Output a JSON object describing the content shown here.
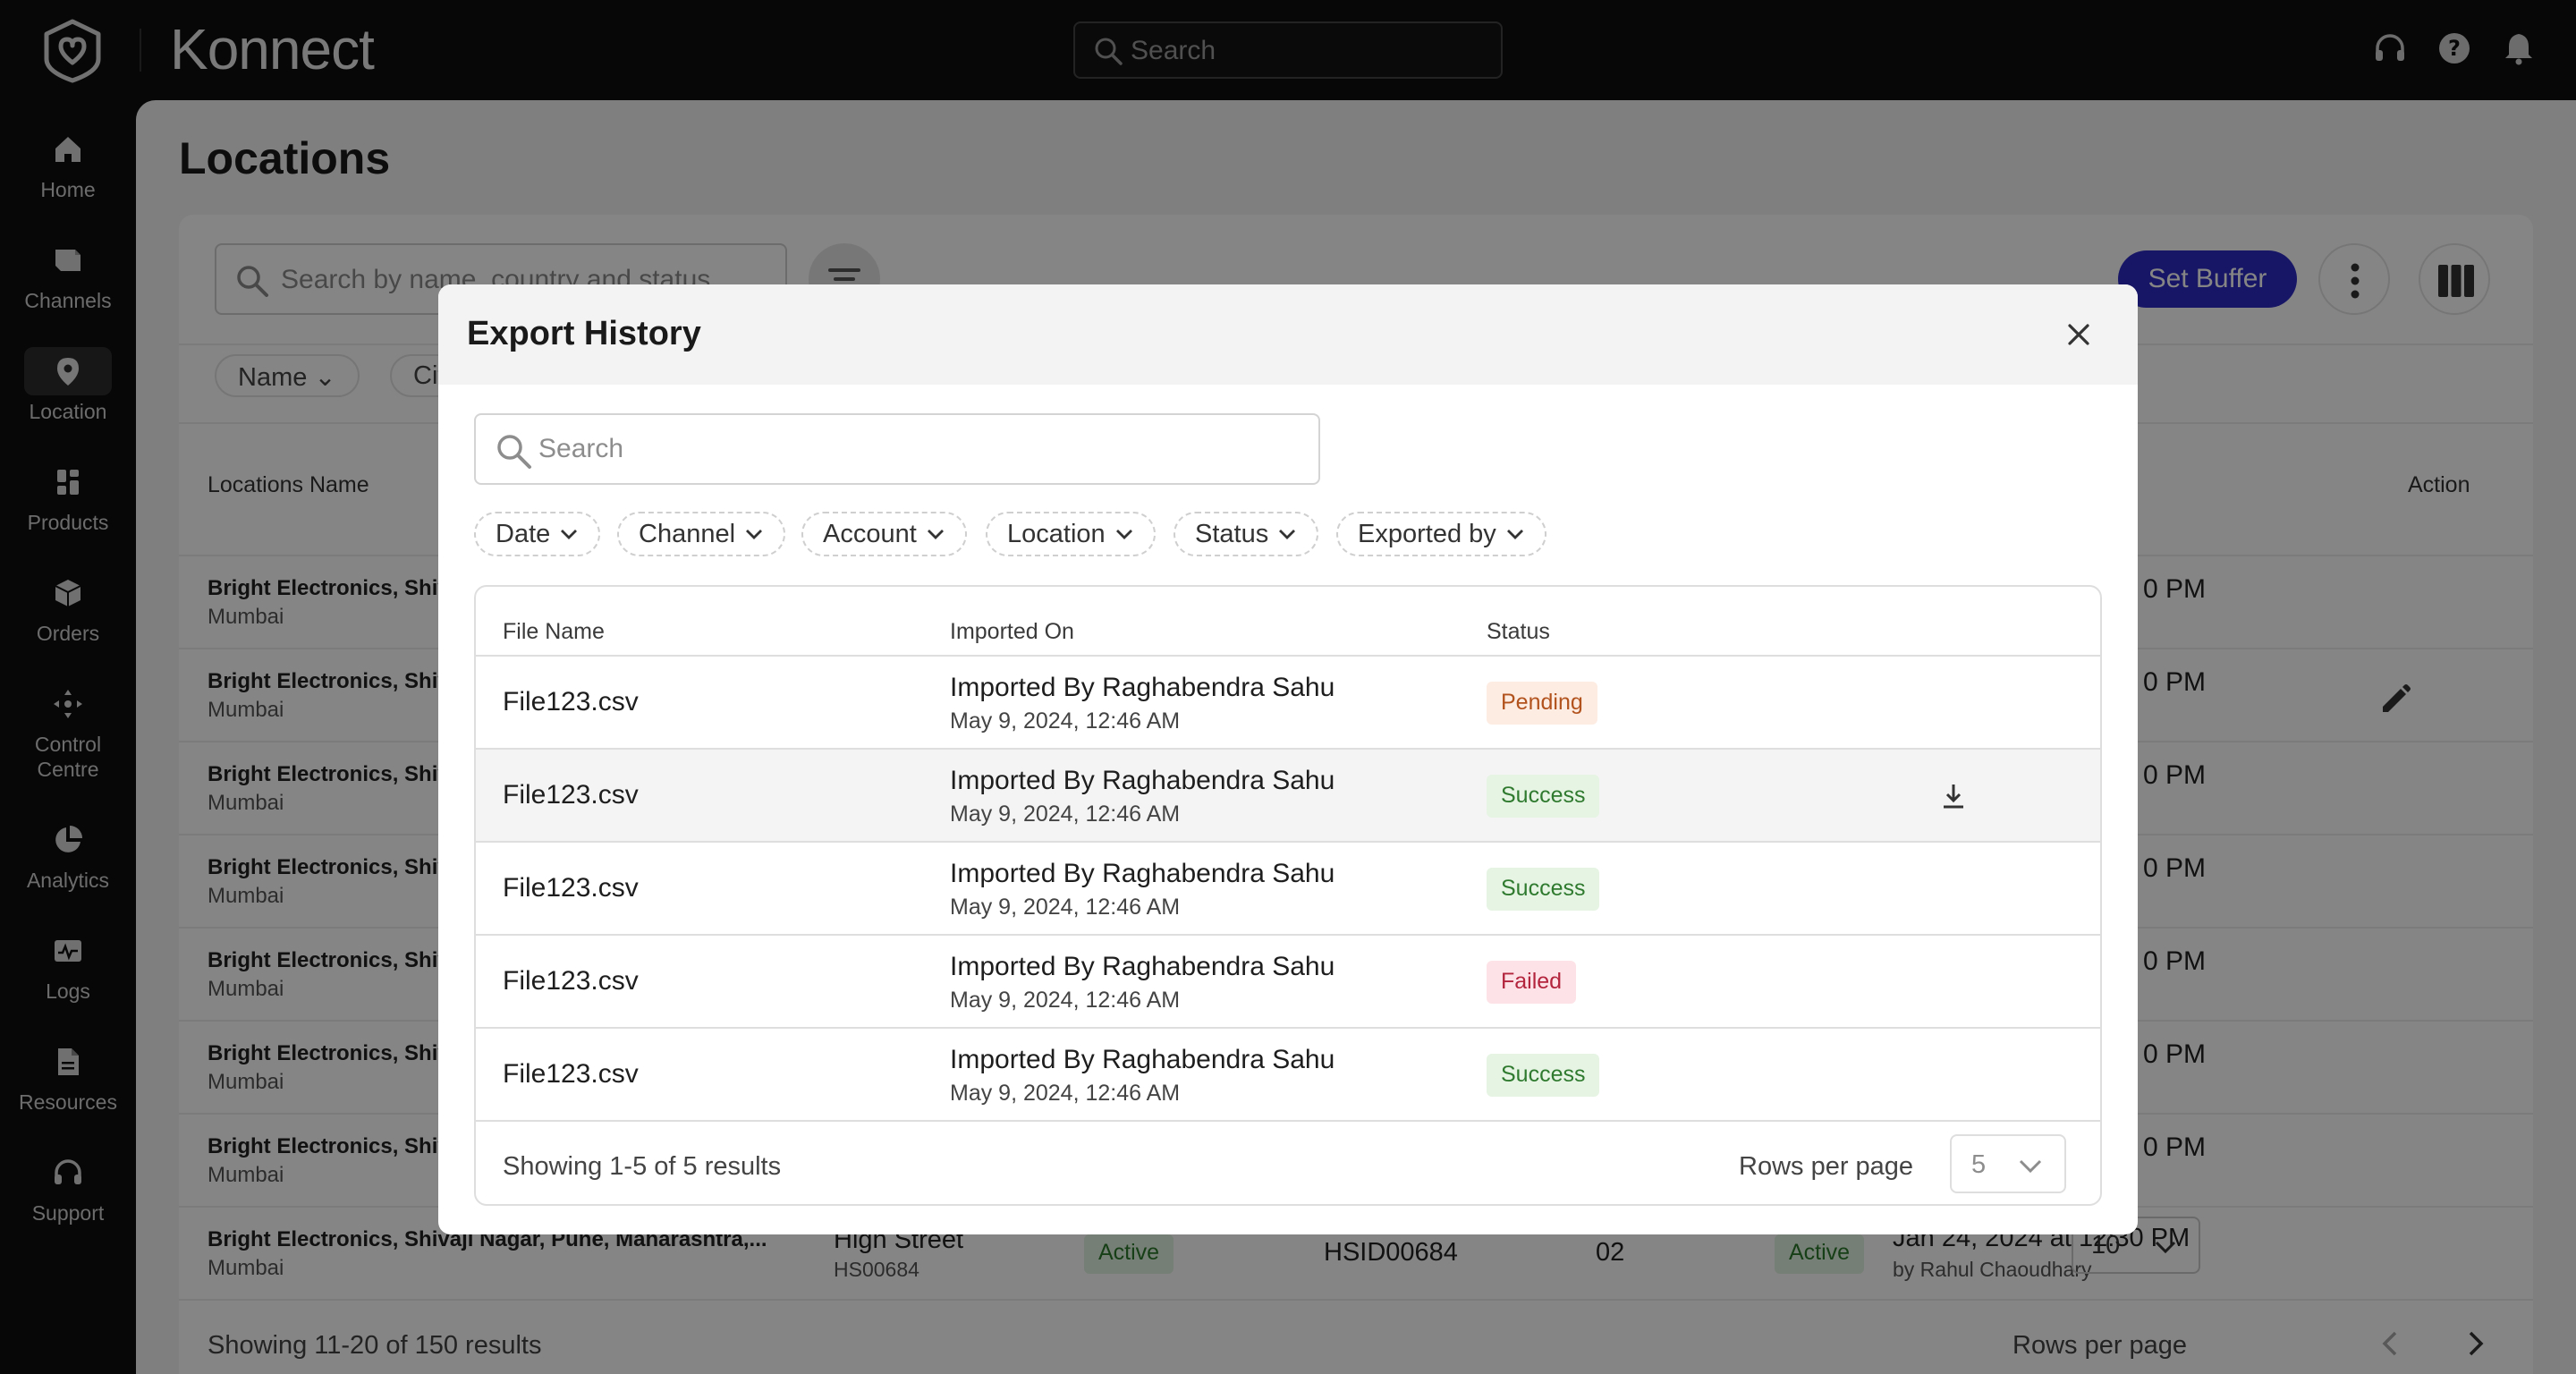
{
  "app": {
    "name": "Konnect",
    "search_placeholder": "Search"
  },
  "sidebar": {
    "items": [
      {
        "label": "Home",
        "icon": "home-icon"
      },
      {
        "label": "Channels",
        "icon": "channels-icon"
      },
      {
        "label": "Location",
        "icon": "location-pin-icon",
        "active": true
      },
      {
        "label": "Products",
        "icon": "products-icon"
      },
      {
        "label": "Orders",
        "icon": "orders-box-icon"
      },
      {
        "label": "Control\nCentre",
        "icon": "control-centre-icon"
      },
      {
        "label": "Analytics",
        "icon": "pie-chart-icon"
      },
      {
        "label": "Logs",
        "icon": "logs-icon"
      },
      {
        "label": "Resources",
        "icon": "document-icon"
      },
      {
        "label": "Support",
        "icon": "headset-icon"
      }
    ]
  },
  "page": {
    "title": "Locations",
    "search_placeholder": "Search by name, country and status",
    "set_buffer_label": "Set Buffer",
    "filter_chips": [
      "Name",
      "City"
    ],
    "columns": {
      "locations_name": "Locations Name",
      "action": "Action"
    },
    "rows": [
      {
        "name": "Bright Electronics, Shiv",
        "city": "Mumbai",
        "time": "0 PM"
      },
      {
        "name": "Bright Electronics, Shiv",
        "city": "Mumbai",
        "time": "0 PM"
      },
      {
        "name": "Bright Electronics, Shiv",
        "city": "Mumbai",
        "time": "0 PM"
      },
      {
        "name": "Bright Electronics, Shiv",
        "city": "Mumbai",
        "time": "0 PM"
      },
      {
        "name": "Bright Electronics, Shiv",
        "city": "Mumbai",
        "time": "0 PM"
      },
      {
        "name": "Bright Electronics, Shiv",
        "city": "Mumbai",
        "time": "0 PM"
      },
      {
        "name": "Bright Electronics, Shiv",
        "city": "Mumbai",
        "time": "0 PM"
      }
    ],
    "last_row": {
      "name": "Bright Electronics, Shivaji Nagar, Pune, Maharashtra,...",
      "city": "Mumbai",
      "street": "High Street",
      "code": "HS00684",
      "status1": "Active",
      "hsid": "HSID00684",
      "num": "02",
      "status2": "Active",
      "datetime": "Jan 24, 2024 at 12:30 PM",
      "by": "by Rahul Chaoudhary"
    },
    "footer": {
      "showing": "Showing 11-20 of 150 results",
      "rows_per_page_label": "Rows per page",
      "rows_per_page_value": "10"
    }
  },
  "modal": {
    "title": "Export History",
    "search_placeholder": "Search",
    "filters": [
      "Date",
      "Channel",
      "Account",
      "Location",
      "Status",
      "Exported by"
    ],
    "columns": {
      "file_name": "File Name",
      "imported_on": "Imported On",
      "status": "Status"
    },
    "rows": [
      {
        "file": "File123.csv",
        "by": "Imported By Raghabendra Sahu",
        "date": "May 9, 2024, 12:46 AM",
        "status": "Pending",
        "download": false
      },
      {
        "file": "File123.csv",
        "by": "Imported By Raghabendra Sahu",
        "date": "May 9, 2024, 12:46 AM",
        "status": "Success",
        "download": true
      },
      {
        "file": "File123.csv",
        "by": "Imported By Raghabendra Sahu",
        "date": "May 9, 2024, 12:46 AM",
        "status": "Success",
        "download": false
      },
      {
        "file": "File123.csv",
        "by": "Imported By Raghabendra Sahu",
        "date": "May 9, 2024, 12:46 AM",
        "status": "Failed",
        "download": false
      },
      {
        "file": "File123.csv",
        "by": "Imported By Raghabendra Sahu",
        "date": "May 9, 2024, 12:46 AM",
        "status": "Success",
        "download": false
      }
    ],
    "footer": {
      "showing": "Showing 1-5 of 5 results",
      "rows_per_page_label": "Rows per page",
      "rows_per_page_value": "5"
    },
    "status_colors": {
      "Pending": {
        "bg": "#fdece2",
        "fg": "#b2531e"
      },
      "Success": {
        "bg": "#e5f4e3",
        "fg": "#2f7a2f"
      },
      "Failed": {
        "bg": "#fde3e7",
        "fg": "#b3243d"
      }
    }
  },
  "colors": {
    "accent": "#2d2ac4",
    "sidebar_bg": "#0e0e0e"
  }
}
